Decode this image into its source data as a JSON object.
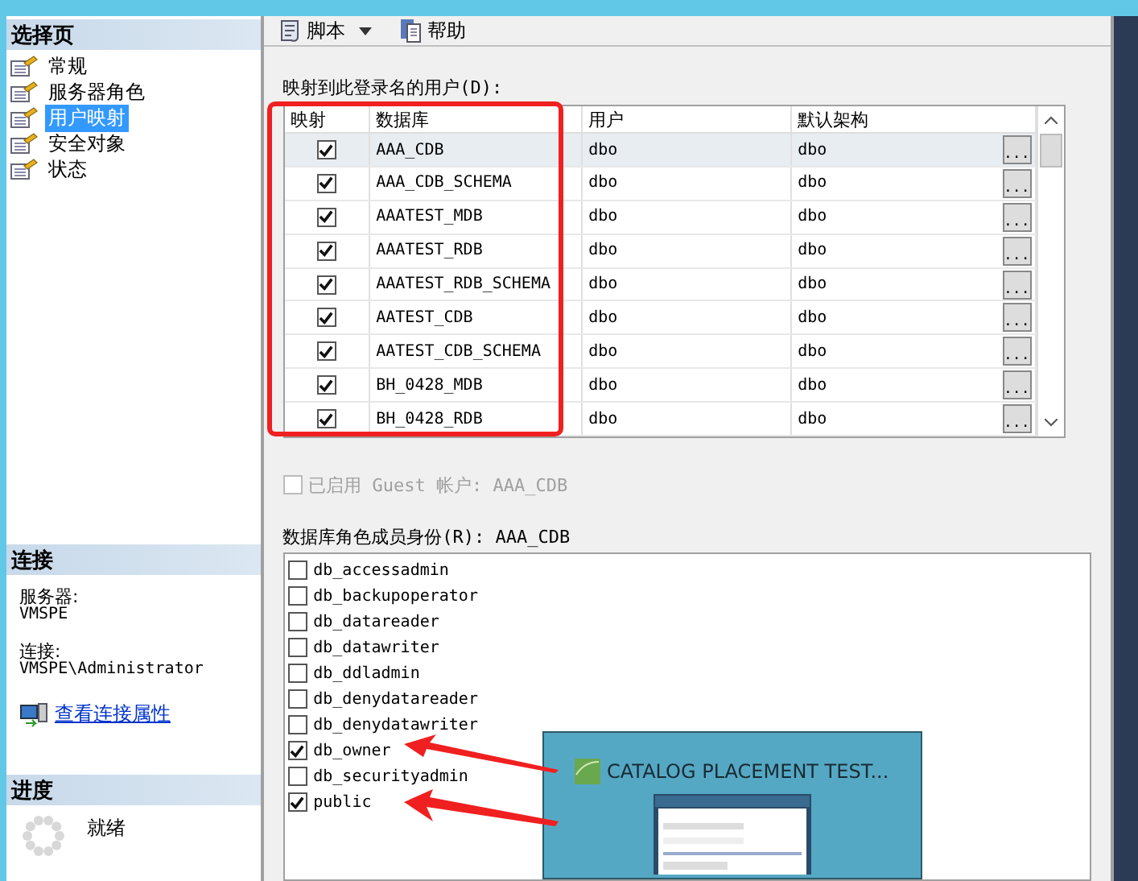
{
  "sidebar": {
    "title": "选择页",
    "items": [
      {
        "label": "常规",
        "selected": false
      },
      {
        "label": "服务器角色",
        "selected": false
      },
      {
        "label": "用户映射",
        "selected": true
      },
      {
        "label": "安全对象",
        "selected": false
      },
      {
        "label": "状态",
        "selected": false
      }
    ],
    "connection": {
      "title": "连接",
      "server_label": "服务器:",
      "server": "VMSPE",
      "connection_label": "连接:",
      "connection": "VMSPE\\Administrator",
      "link": "查看连接属性"
    },
    "progress": {
      "title": "进度",
      "status": "就绪"
    }
  },
  "toolbar": [
    {
      "label": "脚本",
      "kind": "script"
    },
    {
      "label": "帮助",
      "kind": "help"
    }
  ],
  "mapping": {
    "label": "映射到此登录名的用户(D):",
    "columns": [
      "映射",
      "数据库",
      "用户",
      "默认架构"
    ],
    "rows": [
      {
        "checked": true,
        "database": "AAA_CDB",
        "user": "dbo",
        "schema": "dbo",
        "selected": true
      },
      {
        "checked": true,
        "database": "AAA_CDB_SCHEMA",
        "user": "dbo",
        "schema": "dbo",
        "selected": false
      },
      {
        "checked": true,
        "database": "AAATEST_MDB",
        "user": "dbo",
        "schema": "dbo",
        "selected": false
      },
      {
        "checked": true,
        "database": "AAATEST_RDB",
        "user": "dbo",
        "schema": "dbo",
        "selected": false
      },
      {
        "checked": true,
        "database": "AAATEST_RDB_SCHEMA",
        "user": "dbo",
        "schema": "dbo",
        "selected": false
      },
      {
        "checked": true,
        "database": "AATEST_CDB",
        "user": "dbo",
        "schema": "dbo",
        "selected": false
      },
      {
        "checked": true,
        "database": "AATEST_CDB_SCHEMA",
        "user": "dbo",
        "schema": "dbo",
        "selected": false
      },
      {
        "checked": true,
        "database": "BH_0428_MDB",
        "user": "dbo",
        "schema": "dbo",
        "selected": false
      },
      {
        "checked": true,
        "database": "BH_0428_RDB",
        "user": "dbo",
        "schema": "dbo",
        "selected": false
      }
    ],
    "browse_button": "..."
  },
  "guest": {
    "label": "已启用 Guest 帐户: AAA_CDB",
    "checked": false,
    "disabled": true
  },
  "roles": {
    "label": "数据库角色成员身份(R): AAA_CDB",
    "items": [
      {
        "name": "db_accessadmin",
        "checked": false
      },
      {
        "name": "db_backupoperator",
        "checked": false
      },
      {
        "name": "db_datareader",
        "checked": false
      },
      {
        "name": "db_datawriter",
        "checked": false
      },
      {
        "name": "db_ddladmin",
        "checked": false
      },
      {
        "name": "db_denydatareader",
        "checked": false
      },
      {
        "name": "db_denydatawriter",
        "checked": false
      },
      {
        "name": "db_owner",
        "checked": true
      },
      {
        "name": "db_securityadmin",
        "checked": false
      },
      {
        "name": "public",
        "checked": true
      }
    ]
  },
  "thumbnail": {
    "title": "CATALOG PLACEMENT TEST..."
  }
}
